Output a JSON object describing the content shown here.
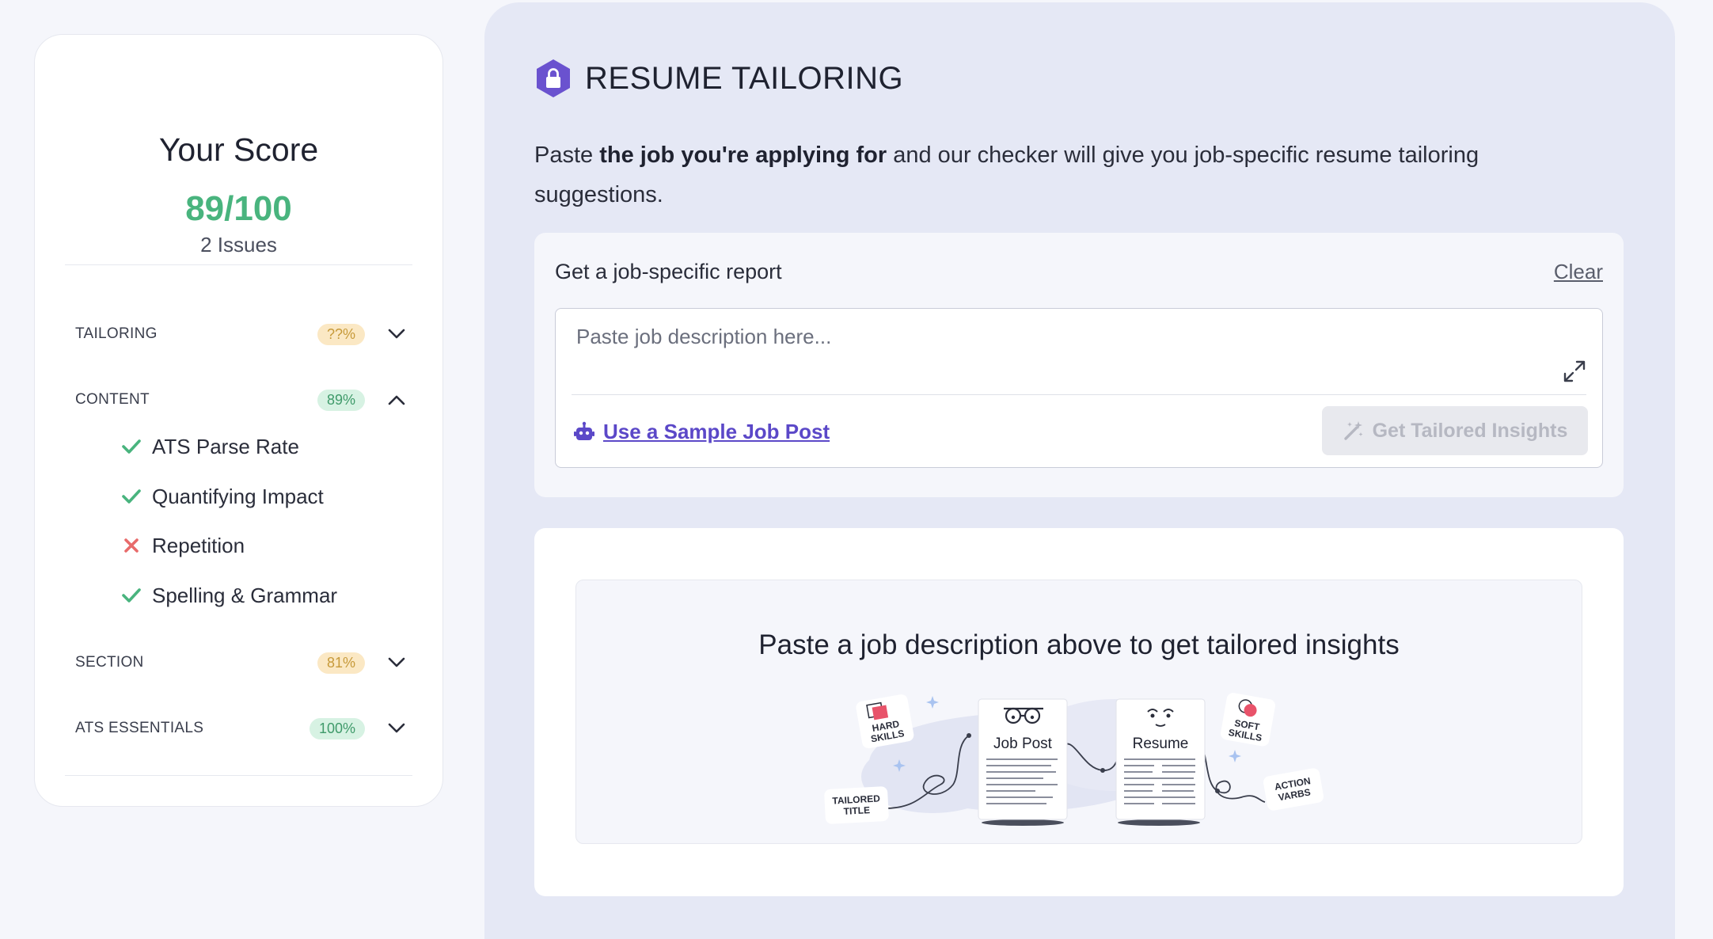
{
  "score": {
    "title": "Your Score",
    "value": "89/100",
    "issues": "2 Issues",
    "categories": [
      {
        "label": "TAILORING",
        "badge": "??%",
        "expanded": false
      },
      {
        "label": "CONTENT",
        "badge": "89%",
        "expanded": true
      },
      {
        "label": "SECTION",
        "badge": "81%",
        "expanded": false
      },
      {
        "label": "ATS ESSENTIALS",
        "badge": "100%",
        "expanded": false
      }
    ],
    "content_items": [
      {
        "label": "ATS Parse Rate",
        "status": "pass"
      },
      {
        "label": "Quantifying Impact",
        "status": "pass"
      },
      {
        "label": "Repetition",
        "status": "fail"
      },
      {
        "label": "Spelling & Grammar",
        "status": "pass"
      }
    ]
  },
  "main": {
    "heading": "RESUME TAILORING",
    "intro_prefix": "Paste ",
    "intro_bold": "the job you're applying for",
    "intro_suffix": " and our checker will give you job-specific resume tailoring suggestions.",
    "report": {
      "title": "Get a job-specific report",
      "clear_label": "Clear",
      "placeholder": "Paste job description here...",
      "sample_link": "Use a Sample Job Post",
      "button_label": "Get Tailored Insights"
    },
    "insights": {
      "message": "Paste a job description above to get tailored insights",
      "illustration": {
        "doc_left": "Job Post",
        "doc_right": "Resume",
        "tag_hard_1": "HARD",
        "tag_hard_2": "SKILLS",
        "tag_soft_1": "SOFT",
        "tag_soft_2": "SKILLS",
        "tag_title_1": "TAILORED",
        "tag_title_2": "TITLE",
        "tag_verbs_1": "ACTION",
        "tag_verbs_2": "VARBS"
      }
    }
  },
  "colors": {
    "accent": "#5b48c8",
    "score_green": "#49b47e",
    "fail_red": "#e86b6b",
    "badge_orange_bg": "#fbe8c4",
    "badge_green_bg": "#d7f2e3",
    "panel_bg": "#e5e8f5"
  }
}
